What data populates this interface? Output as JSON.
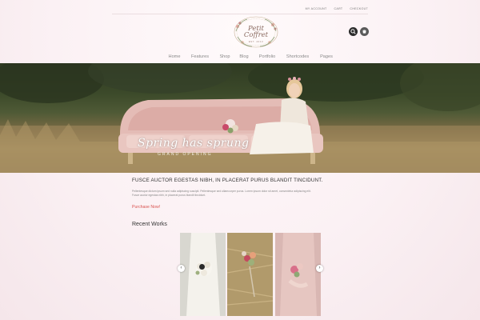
{
  "utility": {
    "items": [
      {
        "label": "My Account"
      },
      {
        "label": "Cart"
      },
      {
        "label": "Checkout"
      }
    ]
  },
  "logo": {
    "title_line1": "Petit",
    "title_line2": "Coffret",
    "sub": "EST. 2013"
  },
  "header": {
    "search_icon": "search-icon",
    "cart_icon": "cart-icon"
  },
  "nav": {
    "items": [
      {
        "label": "Home"
      },
      {
        "label": "Features"
      },
      {
        "label": "Shop"
      },
      {
        "label": "Blog"
      },
      {
        "label": "Portfolio"
      },
      {
        "label": "Shortcodes"
      },
      {
        "label": "Pages"
      }
    ]
  },
  "hero": {
    "title": "Spring has sprung",
    "subtitle": "GRAND OPENING"
  },
  "content": {
    "heading": "FUSCE AUCTOR EGESTAS NIBH, IN PLACERAT PURUS BLANDIT TINCIDUNT.",
    "lorem": "Pellentesque dictum ipsum sed nulla adipiscing suscipit. Pellentesque sed ullamcorper purus. Lorem ipsum dolor sit amet, consectetur adipiscing elit. Fusce auctor egestas nibh, in placerat purus blandit tincidunt.",
    "purchase_label": "Purchase Now!"
  },
  "recent": {
    "title": "Recent Works",
    "prev_icon": "chevron-left-icon",
    "next_icon": "chevron-right-icon",
    "zoom_icon": "zoom-icon"
  },
  "colors": {
    "accent": "#d9534f",
    "background": "#fbf3f5",
    "sofa": "#e8c2bd"
  }
}
